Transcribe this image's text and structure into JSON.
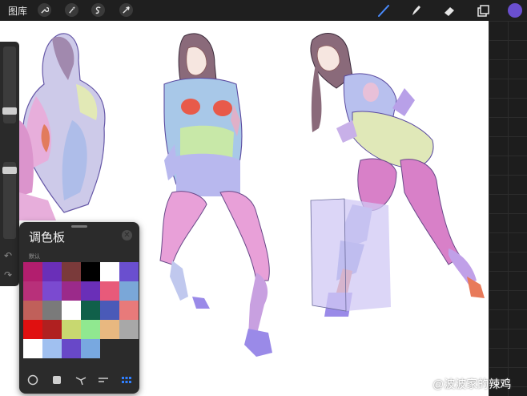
{
  "toolbar": {
    "gallery_label": "图库",
    "tools": [
      "wrench-icon",
      "magic-wand-icon",
      "selection-icon",
      "transform-icon"
    ],
    "right_tools": [
      "brush-icon",
      "smudge-icon",
      "eraser-icon",
      "layers-icon"
    ],
    "current_color": "#6a4fcf"
  },
  "sidebar": {
    "brush_size_level": 0.55,
    "opacity_level": 0.1
  },
  "palette": {
    "title": "调色板",
    "subtitle": "默认",
    "swatches": [
      "#b21e6e",
      "#6a2fb8",
      "#7a3a3a",
      "#000000",
      "#ffffff",
      "#6a4fcf",
      "#b8307a",
      "#7b4ad0",
      "#9b2a8a",
      "#6a2fb8",
      "#e85a7a",
      "#7aa7d8",
      "#c0605a",
      "#7a7a7a",
      "#ffffff",
      "#10604a",
      "#4a5ab8",
      "#e87a7a",
      "#e01010",
      "#b02020",
      "#c8d870",
      "#90e890",
      "#e8b880",
      "#a8a8a8",
      "#ffffff",
      "#a0c0f0",
      "#6848c8",
      "#78a8e0",
      "#2b2b2b",
      "#2b2b2b"
    ],
    "footer_icons": [
      "disc-icon",
      "square-icon",
      "harmony-icon",
      "value-icon",
      "palettes-icon"
    ],
    "active_footer": "palettes-icon"
  },
  "watermark": "@波波家的辣鸡"
}
